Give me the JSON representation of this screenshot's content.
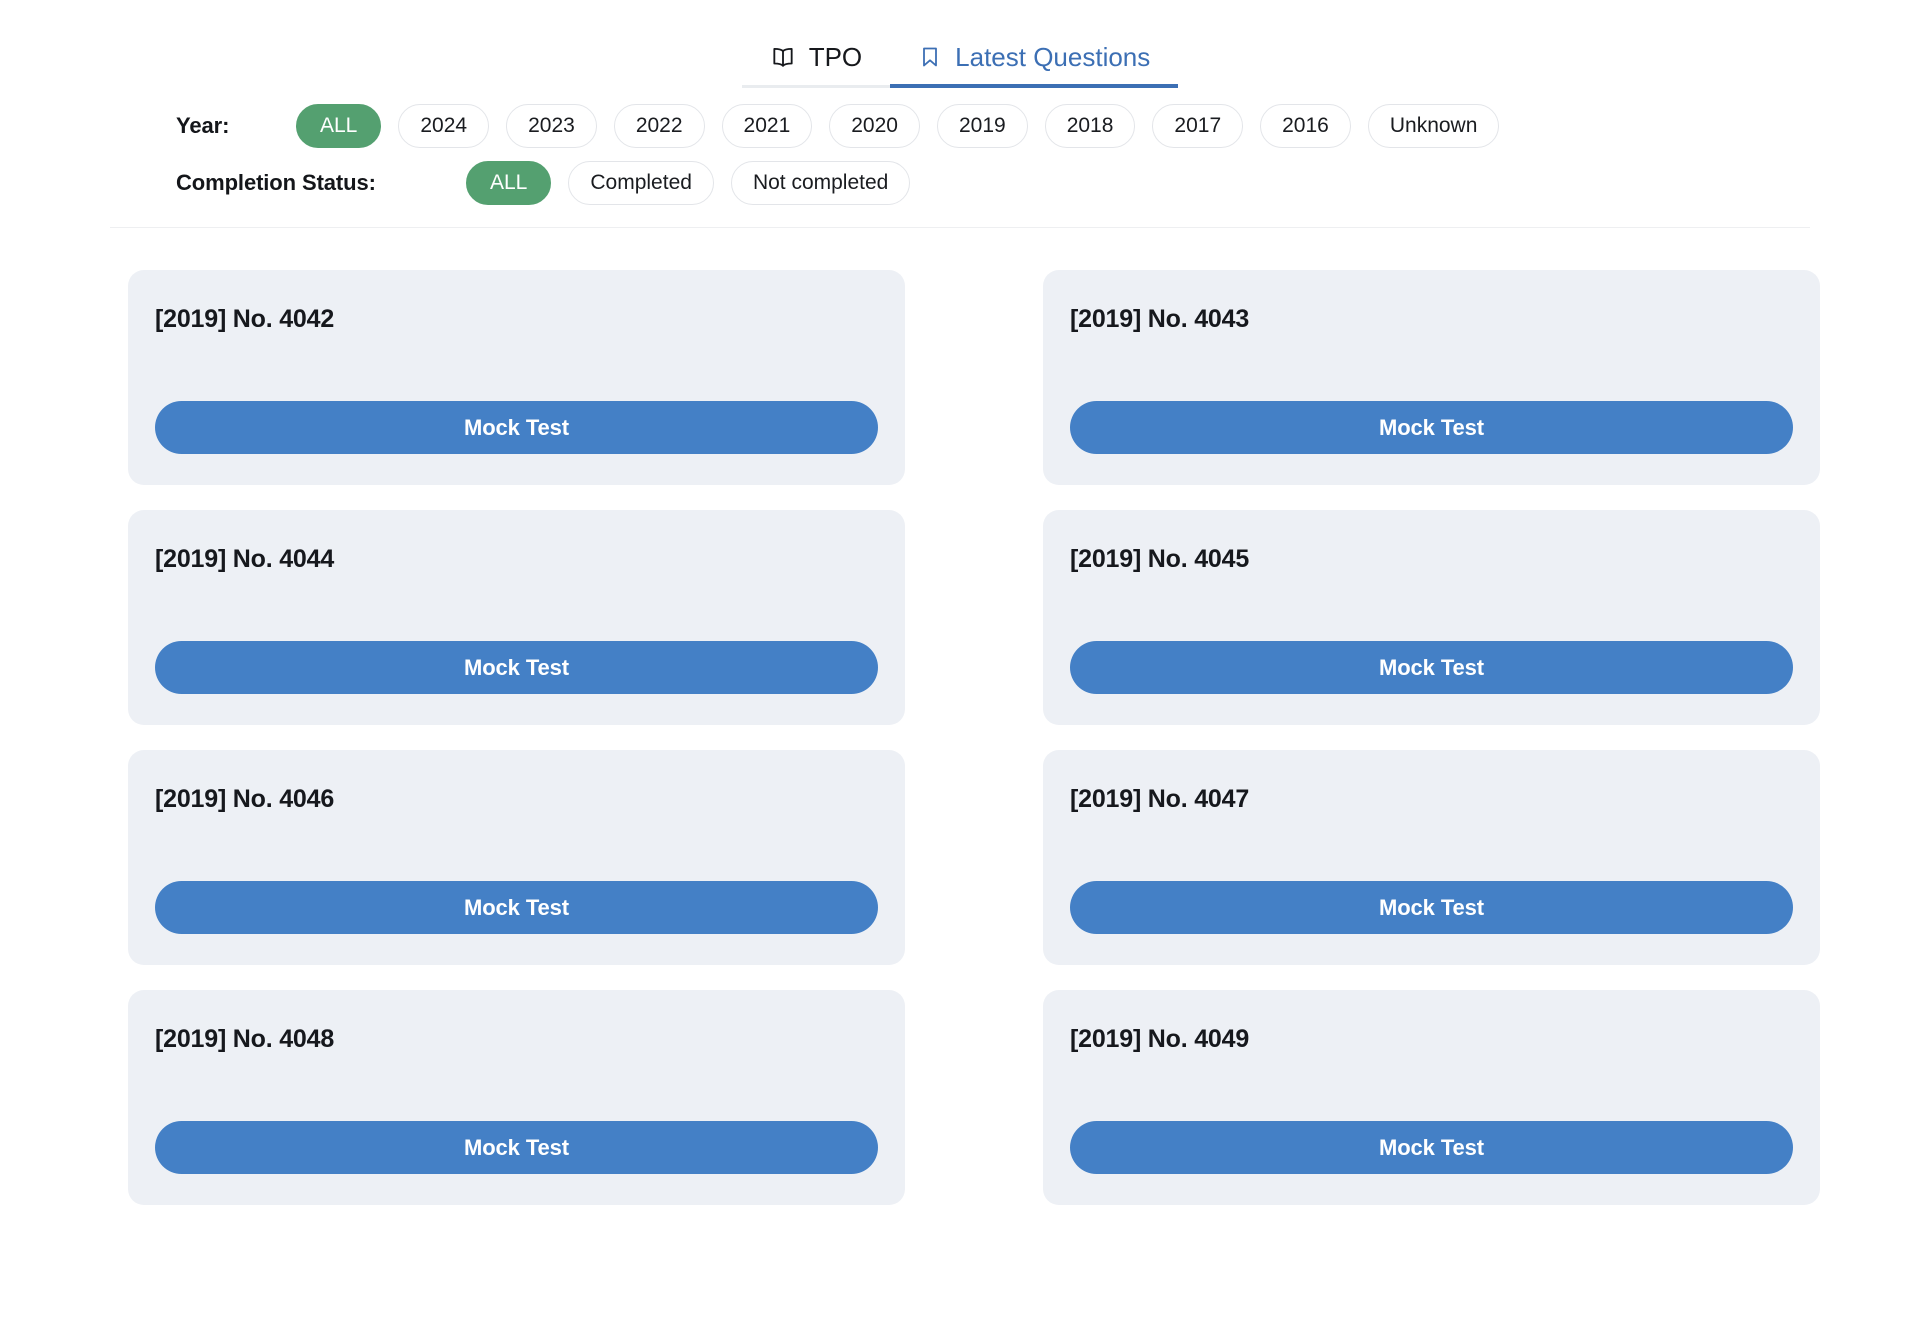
{
  "tabs": [
    {
      "label": "TPO",
      "icon": "book-icon",
      "active": false
    },
    {
      "label": "Latest Questions",
      "icon": "bookmark-icon",
      "active": true
    }
  ],
  "filters": {
    "year": {
      "label": "Year:",
      "options": [
        "ALL",
        "2024",
        "2023",
        "2022",
        "2021",
        "2020",
        "2019",
        "2018",
        "2017",
        "2016",
        "Unknown"
      ],
      "selected": "ALL"
    },
    "completion_status": {
      "label": "Completion Status:",
      "options": [
        "ALL",
        "Completed",
        "Not completed"
      ],
      "selected": "ALL"
    }
  },
  "colors": {
    "accent_blue": "#4480c6",
    "tab_active_blue": "#3c6fb4",
    "selected_green": "#54a070",
    "card_background": "#edf0f5"
  },
  "cards": [
    {
      "title": "[2019] No. 4042",
      "button_label": "Mock Test"
    },
    {
      "title": "[2019] No. 4043",
      "button_label": "Mock Test"
    },
    {
      "title": "[2019] No. 4044",
      "button_label": "Mock Test"
    },
    {
      "title": "[2019] No. 4045",
      "button_label": "Mock Test"
    },
    {
      "title": "[2019] No. 4046",
      "button_label": "Mock Test"
    },
    {
      "title": "[2019] No. 4047",
      "button_label": "Mock Test"
    },
    {
      "title": "[2019] No. 4048",
      "button_label": "Mock Test"
    },
    {
      "title": "[2019] No. 4049",
      "button_label": "Mock Test"
    }
  ]
}
